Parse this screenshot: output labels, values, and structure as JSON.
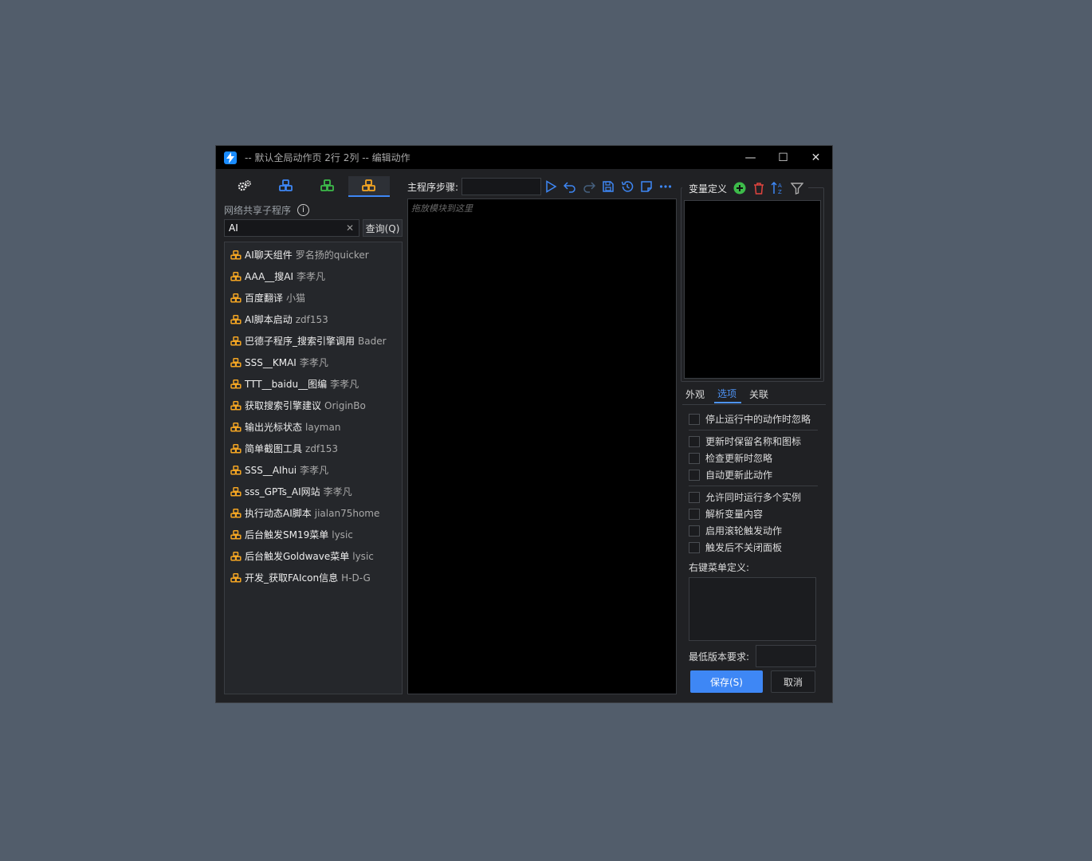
{
  "window": {
    "title": "-- 默认全局动作页 2行 2列 -- 编辑动作",
    "controls": {
      "minimize": "—",
      "maximize": "☐",
      "close": "✕"
    }
  },
  "left": {
    "section_label": "网络共享子程序",
    "search": {
      "value": "AI"
    },
    "query_button": "查询(Q)",
    "results": [
      {
        "name": "AI聊天组件",
        "author": "罗名扬的quicker"
      },
      {
        "name": "AAA__搜AI",
        "author": "李孝凡"
      },
      {
        "name": "百度翻译",
        "author": "小猫"
      },
      {
        "name": "AI脚本启动",
        "author": "zdf153"
      },
      {
        "name": "巴德子程序_搜索引擎调用",
        "author": "Bader"
      },
      {
        "name": "SSS__KMAI",
        "author": "李孝凡"
      },
      {
        "name": "TTT__baidu__图编",
        "author": "李孝凡"
      },
      {
        "name": "获取搜索引擎建议",
        "author": "OriginBo"
      },
      {
        "name": "输出光标状态",
        "author": "layman"
      },
      {
        "name": "简单截图工具",
        "author": "zdf153"
      },
      {
        "name": "SSS__AIhui",
        "author": "李孝凡"
      },
      {
        "name": "sss_GPTs_AI网站",
        "author": "李孝凡"
      },
      {
        "name": "执行动态AI脚本",
        "author": "jialan75home"
      },
      {
        "name": "后台触发SM19菜单",
        "author": "lysic"
      },
      {
        "name": "后台触发Goldwave菜单",
        "author": "lysic"
      },
      {
        "name": "开发_获取FAIcon信息",
        "author": "H-D-G"
      }
    ]
  },
  "middle": {
    "steps_label": "主程序步骤:",
    "canvas_placeholder": "拖放模块到这里"
  },
  "right": {
    "var_label": "变量定义",
    "tabs": [
      "外观",
      "选项",
      "关联"
    ],
    "active_tab": "选项",
    "options_group1": [
      "停止运行中的动作时忽略"
    ],
    "options_group2": [
      "更新时保留名称和图标",
      "检查更新时忽略",
      "自动更新此动作"
    ],
    "options_group3": [
      "允许同时运行多个实例",
      "解析变量内容",
      "启用滚轮触发动作",
      "触发后不关闭面板"
    ],
    "context_menu_label": "右键菜单定义:",
    "min_version_label": "最低版本要求:",
    "save_button": "保存(S)",
    "cancel_button": "取消"
  }
}
